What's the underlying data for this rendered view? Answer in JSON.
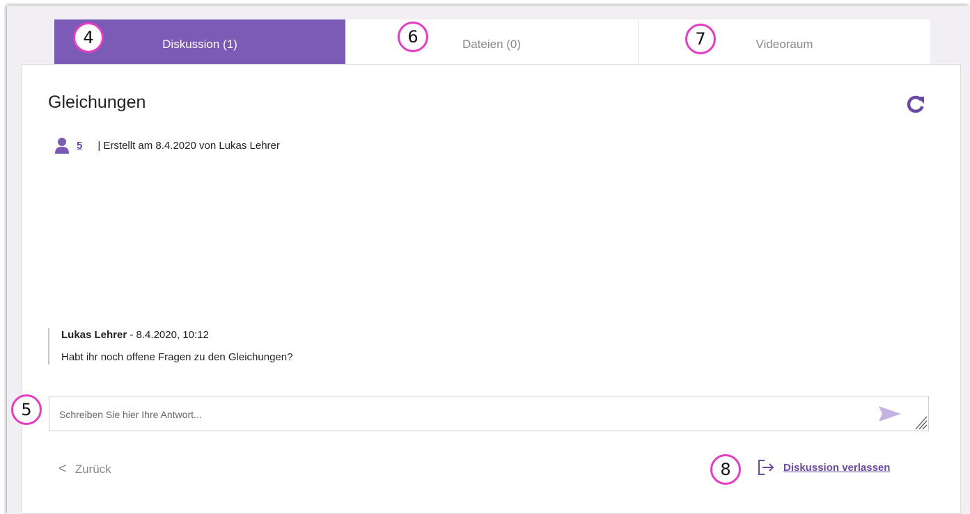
{
  "tabs": [
    {
      "label": "Diskussion (1)"
    },
    {
      "label": "Dateien (0)"
    },
    {
      "label": "Videoraum"
    }
  ],
  "discussion": {
    "title": "Gleichungen",
    "participant_count": "5",
    "created_info": "| Erstellt am 8.4.2020 von Lukas Lehrer"
  },
  "message": {
    "author": "Lukas Lehrer",
    "date": " - 8.4.2020, 10:12",
    "text": "Habt ihr noch offene Fragen zu den Gleichungen?"
  },
  "reply": {
    "placeholder": "Schreiben Sie hier Ihre Antwort..."
  },
  "footer": {
    "back_label": "Zurück",
    "back_chevron": "<",
    "leave_label": "Diskussion verlassen"
  },
  "annotations": [
    "4",
    "6",
    "7",
    "5",
    "8"
  ],
  "colors": {
    "accent": "#7b5bb5",
    "annotation": "#e83bc4",
    "send_icon": "#c3b2e2"
  },
  "icons": [
    "refresh-icon",
    "user-icon",
    "send-icon",
    "resize-handle-icon",
    "chevron-left-icon",
    "logout-icon"
  ]
}
